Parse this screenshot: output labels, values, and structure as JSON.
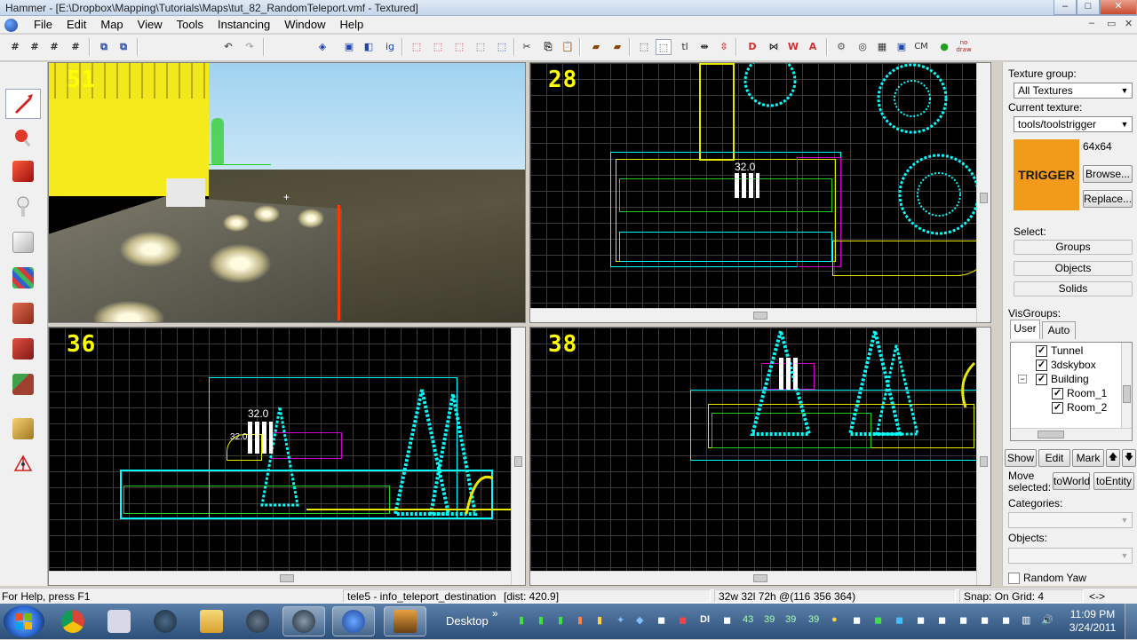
{
  "window": {
    "title": "Hammer - [E:\\Dropbox\\Mapping\\Tutorials\\Maps\\tut_82_RandomTeleport.vmf - Textured]",
    "min": "–",
    "max": "□",
    "close": "✕"
  },
  "menu": {
    "items": [
      "File",
      "Edit",
      "Map",
      "View",
      "Tools",
      "Instancing",
      "Window",
      "Help"
    ],
    "mdi_min": "–",
    "mdi_restore": "▭",
    "mdi_close": "✕"
  },
  "toolbar": {
    "text_buttons": {
      "ig": "ig",
      "tl": "tl",
      "cm": "CM",
      "nodraw": "no draw"
    }
  },
  "viewports": {
    "camera": {
      "label": "51"
    },
    "top": {
      "label": "28",
      "dim": "32.0"
    },
    "front": {
      "label": "36",
      "dim": "32.0",
      "dim2": "32.0"
    },
    "side": {
      "label": "38"
    }
  },
  "right_panel": {
    "texture_group_label": "Texture group:",
    "texture_group_value": "All Textures",
    "current_texture_label": "Current texture:",
    "current_texture_value": "tools/toolstrigger",
    "texture_size": "64x64",
    "texture_preview_text": "TRIGGER",
    "browse": "Browse...",
    "replace": "Replace...",
    "select_label": "Select:",
    "select_groups": "Groups",
    "select_objects": "Objects",
    "select_solids": "Solids",
    "visgroups_label": "VisGroups:",
    "tab_user": "User",
    "tab_auto": "Auto",
    "visgroups": [
      {
        "name": "Tunnel",
        "checked": true
      },
      {
        "name": "3dskybox",
        "checked": true
      },
      {
        "name": "Building",
        "checked": true,
        "expander": "−"
      },
      {
        "name": "Room_1",
        "checked": true
      },
      {
        "name": "Room_2",
        "checked": true
      }
    ],
    "show": "Show",
    "edit": "Edit",
    "mark": "Mark",
    "up": "🡅",
    "down": "🡇",
    "move_selected_label": "Move selected:",
    "to_world": "toWorld",
    "to_entity": "toEntity",
    "categories_label": "Categories:",
    "objects_label": "Objects:",
    "random_yaw": "Random Yaw"
  },
  "status": {
    "help": "For Help, press F1",
    "selection": "tele5 - info_teleport_destination",
    "dist": "[dist: 420.9]",
    "size": "32w 32l 72h @(116 356 364)",
    "snap": "Snap: On Grid: 4",
    "arrows": "<->"
  },
  "taskbar": {
    "desktop": "Desktop",
    "chevron": "»",
    "tray_numbers": [
      "43",
      "39",
      "39",
      "39"
    ],
    "tray_di": "DI",
    "time": "11:09 PM",
    "date": "3/24/2011"
  },
  "colors": {
    "viewport_label": "#ffff00",
    "wire_cyan": "#00ffff",
    "wire_yellow": "#e8e800",
    "wire_magenta": "#d000d0",
    "wire_green": "#20d020",
    "grid": "#3a3a3a",
    "texture_preview": "#f29a1a"
  }
}
